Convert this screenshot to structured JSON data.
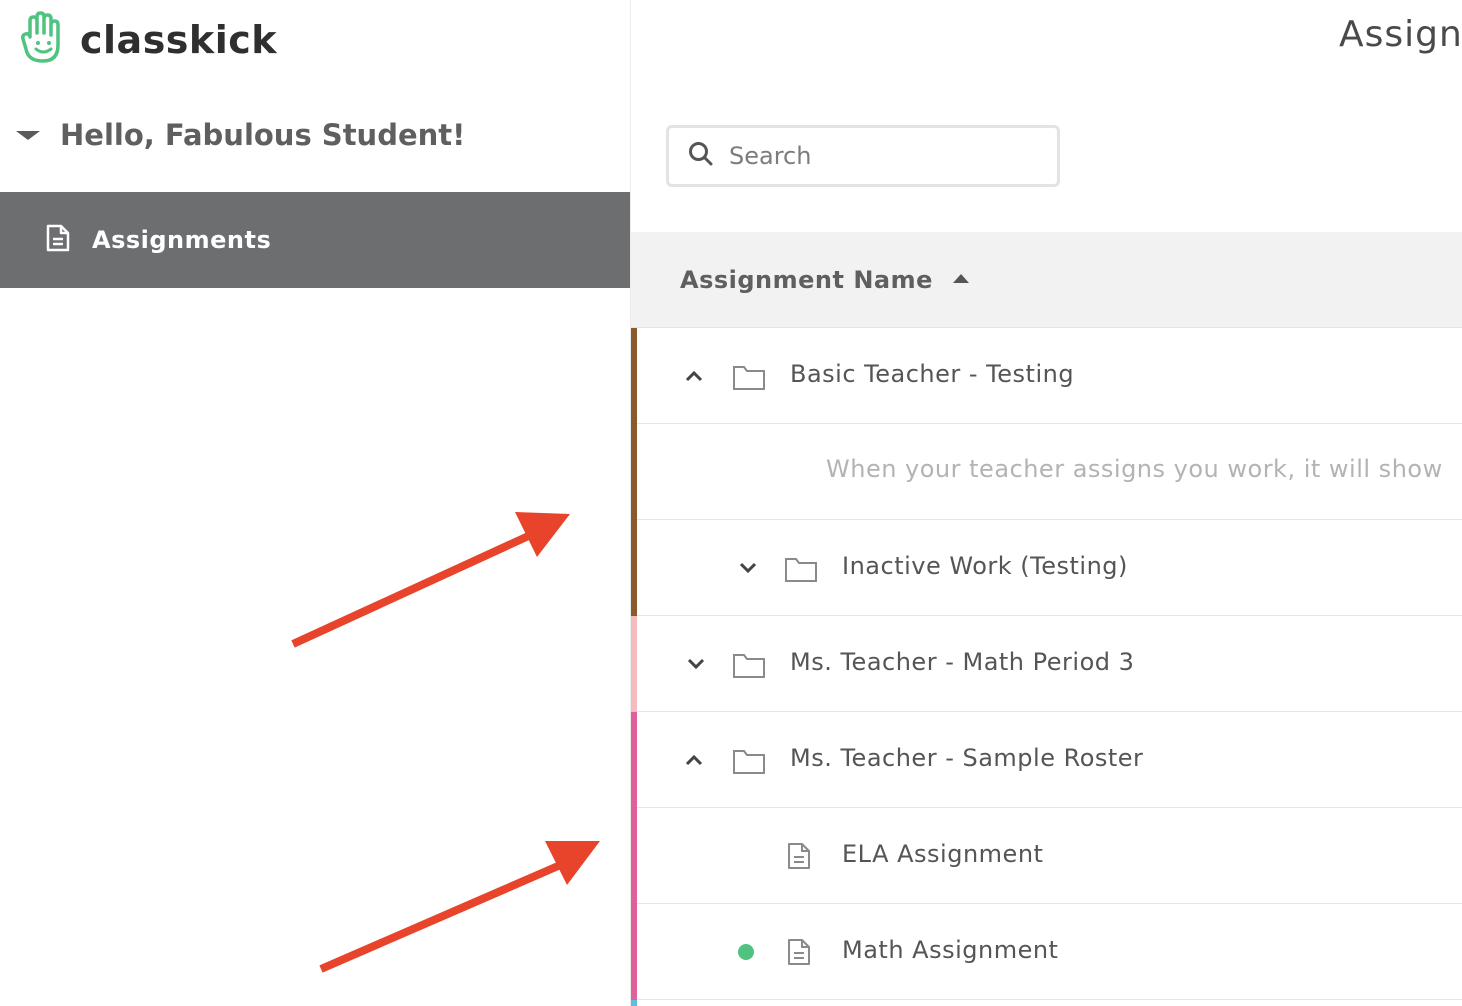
{
  "app": {
    "brand": "classkick",
    "brand_color": "#4fc37f"
  },
  "sidebar": {
    "greeting": "Hello, Fabulous Student!",
    "items": [
      {
        "label": "Assignments",
        "icon": "document-icon",
        "active": true
      }
    ]
  },
  "main": {
    "title": "Assignments",
    "search": {
      "placeholder": "Search",
      "value": ""
    },
    "table": {
      "column_header": "Assignment Name",
      "sort": "ascending"
    },
    "rows": [
      {
        "type": "folder",
        "label": "Basic Teacher - Testing",
        "expanded": true,
        "stripe_color": "#8b5a2b"
      },
      {
        "type": "empty",
        "label": "When your teacher assigns you work, it will show",
        "stripe_color": "#8b5a2b"
      },
      {
        "type": "folder",
        "label": "Inactive Work (Testing)",
        "expanded": false,
        "stripe_color": "#8b5a2b"
      },
      {
        "type": "folder",
        "label": "Ms. Teacher - Math Period 3",
        "expanded": false,
        "stripe_color": "#f4bcbc"
      },
      {
        "type": "folder",
        "label": "Ms. Teacher - Sample Roster",
        "expanded": true,
        "stripe_color": "#e0609a"
      },
      {
        "type": "assignment",
        "label": "ELA Assignment",
        "new": false,
        "stripe_color": "#e0609a"
      },
      {
        "type": "assignment",
        "label": "Math Assignment",
        "new": true,
        "stripe_color": "#e0609a"
      }
    ],
    "new_indicator_color": "#4fc37f",
    "next_stripe_color": "#5bc0de"
  },
  "annotations": {
    "arrow_color": "#e8432b"
  }
}
